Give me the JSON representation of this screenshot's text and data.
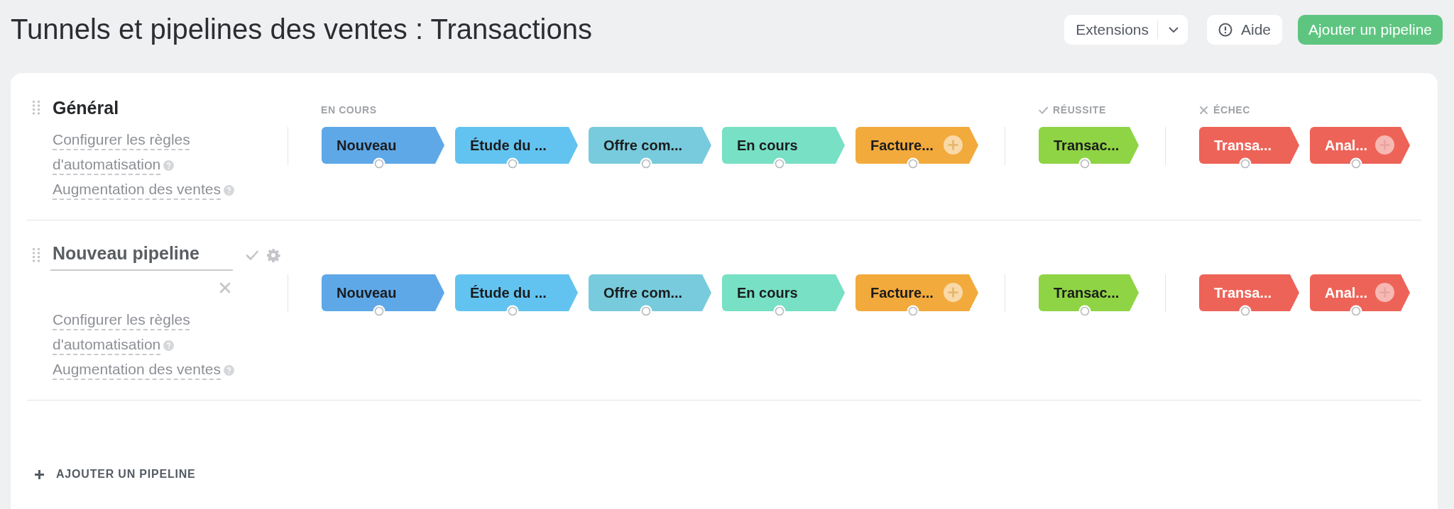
{
  "page_title": "Tunnels et pipelines des ventes : Transactions",
  "header_buttons": {
    "extensions": "Extensions",
    "help": "Aide",
    "add_pipeline": "Ajouter un pipeline"
  },
  "pipelines": [
    {
      "name": "Général",
      "editing": false,
      "links": [
        "Configurer les règles d'automatisation",
        "Augmentation des ventes"
      ],
      "groups": [
        {
          "kind": "in_progress",
          "header": "EN COURS",
          "stages": [
            {
              "label": "Nouveau",
              "color": "#5ea8e8",
              "add_button": false
            },
            {
              "label": "Étude du ...",
              "color": "#63c3f0",
              "add_button": false
            },
            {
              "label": "Offre com...",
              "color": "#78cbdc",
              "add_button": false
            },
            {
              "label": "En cours",
              "color": "#78e0c4",
              "add_button": false
            },
            {
              "label": "Facture...",
              "color": "#f2aa3c",
              "add_button": true
            }
          ]
        },
        {
          "kind": "success",
          "header": "RÉUSSITE",
          "stages": [
            {
              "label": "Transac...",
              "color": "#8fd444",
              "add_button": false
            }
          ]
        },
        {
          "kind": "failure",
          "header": "ÉCHEC",
          "stages": [
            {
              "label": "Transa...",
              "color": "#ee6358",
              "add_button": false
            },
            {
              "label": "Anal...",
              "color": "#ee6358",
              "add_button": true
            }
          ]
        }
      ]
    },
    {
      "name": "Nouveau pipeline",
      "editing": true,
      "links": [
        "Configurer les règles d'automatisation",
        "Augmentation des ventes"
      ],
      "groups": [
        {
          "kind": "in_progress",
          "stages": [
            {
              "label": "Nouveau",
              "color": "#5ea8e8",
              "add_button": false
            },
            {
              "label": "Étude du ...",
              "color": "#63c3f0",
              "add_button": false
            },
            {
              "label": "Offre com...",
              "color": "#78cbdc",
              "add_button": false
            },
            {
              "label": "En cours",
              "color": "#78e0c4",
              "add_button": false
            },
            {
              "label": "Facture...",
              "color": "#f2aa3c",
              "add_button": true
            }
          ]
        },
        {
          "kind": "success",
          "stages": [
            {
              "label": "Transac...",
              "color": "#8fd444",
              "add_button": false
            }
          ]
        },
        {
          "kind": "failure",
          "stages": [
            {
              "label": "Transa...",
              "color": "#ee6358",
              "add_button": false
            },
            {
              "label": "Anal...",
              "color": "#ee6358",
              "add_button": true
            }
          ]
        }
      ]
    }
  ],
  "add_pipeline_link": "AJOUTER UN PIPELINE"
}
